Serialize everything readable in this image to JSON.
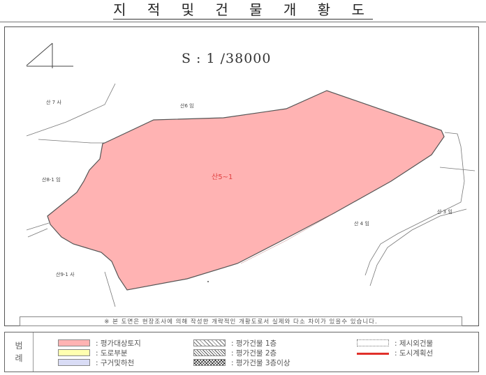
{
  "title": "지 적 및 건 물 개 황 도",
  "scale": "S : 1 /38000",
  "parcels": {
    "main": "산5~1",
    "san7": "산 7 사",
    "san6": "산6 임",
    "san8_1": "산8-1 임",
    "san4": "산 4 임",
    "san3": "산 3 임",
    "san9_1": "산9-1 사"
  },
  "colors": {
    "subject_land": "#ffb3b3",
    "road": "#ffffb0",
    "ditch_stream": "#d9dcf5",
    "city_plan_line": "#e0302a",
    "parcel_label": "#e04040"
  },
  "note": "※ 본 도면은 현장조사에 의해 작성한 개략적인 개황도로서 실제와 다소 차이가 있을수 있습니다.",
  "legend": {
    "title": "범 례",
    "items": [
      {
        "label": ": 평가대상토지",
        "swatch": "subject-land"
      },
      {
        "label": ": 도로부분",
        "swatch": "road"
      },
      {
        "label": ": 구거및하천",
        "swatch": "ditch-stream"
      },
      {
        "label": ": 평가건물 1층",
        "swatch": "building-1f"
      },
      {
        "label": ": 평가건물 2층",
        "swatch": "building-2f"
      },
      {
        "label": ": 평가건물 3층이상",
        "swatch": "building-3f-plus"
      },
      {
        "label": ": 제시외건물",
        "swatch": "unlisted-building"
      },
      {
        "label": ": 도시계획선",
        "swatch": "city-plan-line"
      }
    ]
  }
}
